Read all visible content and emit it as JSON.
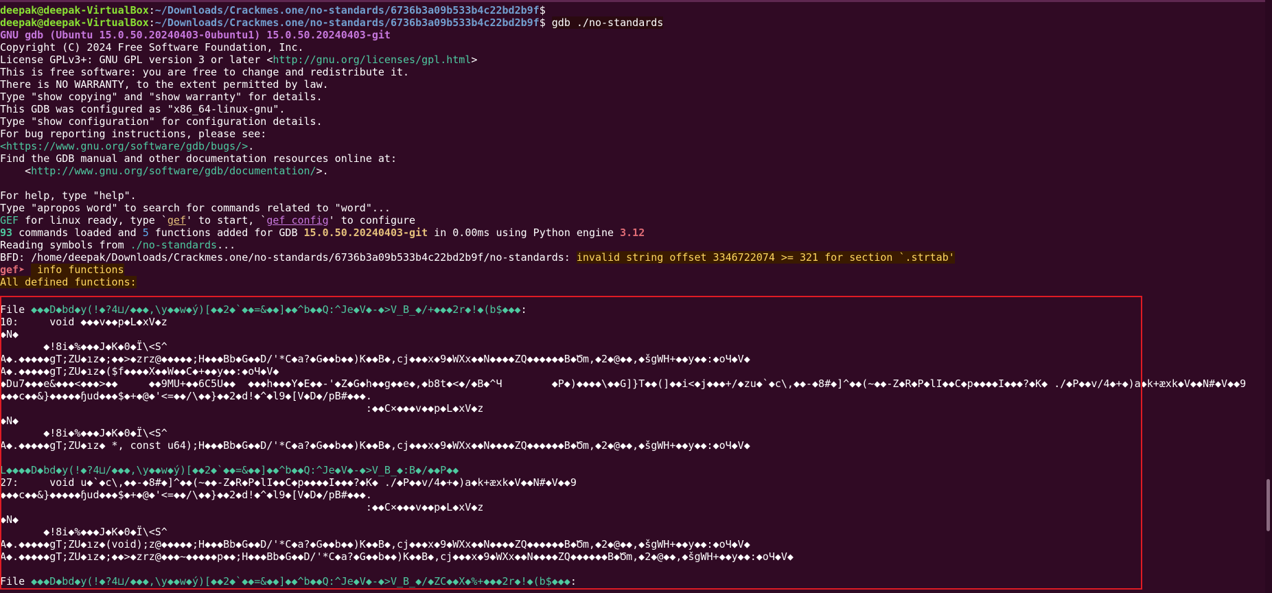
{
  "prompt": {
    "user": "deepak@deepak-VirtualBox",
    "path": "~/Downloads/Crackmes.one/no-standards/6736b3a09b533b4c22bd2b9f",
    "symbol": "$"
  },
  "cmd_gdb": "gdb ./no-standards",
  "gdb_version": "GNU gdb (Ubuntu 15.0.50.20240403-0ubuntu1) 15.0.50.20240403-git",
  "copyright": "Copyright (C) 2024 Free Software Foundation, Inc.",
  "license_pre": "License GPLv3+: GNU GPL version 3 or later <",
  "license_url": "http://gnu.org/licenses/gpl.html",
  "license_post": ">",
  "free_sw": "This is free software: you are free to change and redistribute it.",
  "no_warranty": "There is NO WARRANTY, to the extent permitted by law.",
  "show_copying": "Type \"show copying\" and \"show warranty\" for details.",
  "configured": "This GDB was configured as \"x86_64-linux-gnu\".",
  "show_config": "Type \"show configuration\" for configuration details.",
  "bug_report": "For bug reporting instructions, please see:",
  "bug_url": "<https://www.gnu.org/software/gdb/bugs/>",
  "bug_post": ".",
  "find_manual": "Find the GDB manual and other documentation resources online at:",
  "doc_pre": "    <",
  "doc_url": "http://www.gnu.org/software/gdb/documentation/",
  "doc_post": ">.",
  "help": "For help, type \"help\".",
  "apropos": "Type \"apropos word\" to search for commands related to \"word\"...",
  "gef_ready": {
    "a": "GEF",
    "b": " for linux ready, type `",
    "c": "gef",
    "d": "' to start, `",
    "e": "gef config",
    "f": "' to configure"
  },
  "commands_loaded": {
    "n1": "93",
    "t1": " commands loaded and ",
    "n2": "5",
    "t2": " functions added for GDB ",
    "ver": "15.0.50.20240403-git",
    "t3": " in 0.00ms using Python engine ",
    "py": "3.12"
  },
  "reading_pre": "Reading symbols from ",
  "reading_file": "./no-standards",
  "reading_post": "...",
  "bfd_pre": "BFD: /home/deepak/Downloads/Crackmes.one/no-standards/6736b3a09b533b4c22bd2b9f/no-standards: ",
  "bfd_error": "invalid string offset 3346722074 >= 321 for section `.strtab'",
  "gef_prompt": "gef➤ ",
  "cmd_info": " info functions",
  "all_defined": "All defined functions:",
  "garbled_lines": [
    {
      "a": "File ",
      "g": "◆◆◆D◆bd◆y(!◆?4⊔/◆◆◆,\\y◆◆w◆ý)[◆◆2◆`◆◆=&◆◆]◆◆^b◆◆Q:^Je◆V◆-◆>V̲B̲◆/+◆◆◆2r◆!◆(b$◆◆◆",
      "b": ":"
    },
    {
      "a": "10:     void ◆◆◆v◆◆p◆L◆xV◆z",
      "g": "",
      "b": ""
    },
    {
      "a": "◆N◆",
      "g": "",
      "b": ""
    },
    {
      "a": "       ◆!8i◆%◆◆◆J◆K◆0◆Ï\\<S^",
      "g": "",
      "b": ""
    },
    {
      "a": "A◆.◆◆◆◆◆gT;ZU◆ız◆;◆◆>◆zrz@◆◆◆◆◆;H◆◆◆Bb◆G◆◆D/'*C◆a?◆G◆◆b◆◆)K◆◆B◆,cj◆◆◆x◆9◆WXx◆◆N◆◆◆◆ZQ◆◆◆◆◆◆B◆Ծm,◆2◆@◆◆,◆šgWH+◆◆y◆◆:◆oЧ◆V◆",
      "g": "",
      "b": ""
    },
    {
      "a": "A◆.◆◆◆◆◆gT;ZU◆ız◆($f◆◆◆◆X◆◆W◆◆C◆+◆◆y◆◆:◆oЧ◆V◆",
      "g": "",
      "b": ""
    },
    {
      "a": "◆Du7◆◆◆e&◆◆◆<◆◆◆>◆◆     ◆◆9MU+◆◆6C5U◆◆  ◆◆◆h◆◆◆Y◆E◆◆-'◆Z◆G◆h◆◆g◆◆e◆,◆b8t◆<◆/◆B◆^Ч        ◆P◆)◆◆◆◆\\◆◆G]}T◆◆(]◆◆i<◆j◆◆◆+/◆zu◆`◆c\\,◆◆-◆8#◆]^◆◆(~◆◆-Z◆R◆P◆lI◆◆C◆p◆◆◆◆I◆◆◆?◆K◆ ./◆P◆◆v/4◆+◆)a◆k+æxk◆V◆◆N#◆V◆◆9",
      "g": "",
      "b": ""
    },
    {
      "a": "◆◆◆c◆◆&}◆◆◆◆◆ɧud◆◆◆$◆+◆@◆'<=◆◆/\\◆◆}◆◆2◆d!◆^◆l9◆[V◆D◆/pB#◆◆◆.",
      "g": "",
      "b": ""
    },
    {
      "a": "                                                           :◆◆C×◆◆◆v◆◆p◆L◆xV◆z",
      "g": "",
      "b": ""
    },
    {
      "a": "◆N◆",
      "g": "",
      "b": ""
    },
    {
      "a": "       ◆!8i◆%◆◆◆J◆K◆0◆Ï\\<S^",
      "g": "",
      "b": ""
    },
    {
      "a": "A◆.◆◆◆◆◆gT;ZU◆ız◆ *, const u64);H◆◆◆Bb◆G◆◆D/'*C◆a?◆G◆◆b◆◆)K◆◆B◆,cj◆◆◆x◆9◆WXx◆◆N◆◆◆◆ZQ◆◆◆◆◆◆B◆Ծm,◆2◆@◆◆,◆šgWH+◆◆y◆◆:◆oЧ◆V◆",
      "g": "",
      "b": ""
    },
    {
      "a": "",
      "g": "",
      "b": ""
    },
    {
      "a": "",
      "g": "L◆◆◆◆D◆bd◆y(!◆?4⊔/◆◆◆,\\y◆◆w◆ý)[◆◆2◆`◆◆=&◆◆]◆◆^b◆◆Q:^Je◆V◆-◆>V̲B̲◆:B◆/◆◆P◆◆",
      "b": ""
    },
    {
      "a": "27:     void u◆`◆c\\,◆◆-◆8#◆]^◆◆(~◆◆-Z◆R◆P◆lI◆◆C◆p◆◆◆◆I◆◆◆?◆K◆ ./◆P◆◆v/4◆+◆)a◆k+æxk◆V◆◆N#◆V◆◆9",
      "g": "",
      "b": ""
    },
    {
      "a": "◆◆◆c◆◆&}◆◆◆◆◆ɧud◆◆◆$◆+◆@◆'<=◆◆/\\◆◆}◆◆2◆d!◆^◆l9◆[V◆D◆/pB#◆◆◆.",
      "g": "",
      "b": ""
    },
    {
      "a": "                                                           :◆◆C×◆◆◆v◆◆p◆L◆xV◆z",
      "g": "",
      "b": ""
    },
    {
      "a": "◆N◆",
      "g": "",
      "b": ""
    },
    {
      "a": "       ◆!8i◆%◆◆◆J◆K◆0◆Ï\\<S^",
      "g": "",
      "b": ""
    },
    {
      "a": "A◆.◆◆◆◆◆gT;ZU◆ız◆(void);z@◆◆◆◆◆;H◆◆◆Bb◆G◆◆D/'*C◆a?◆G◆◆b◆◆)K◆◆B◆,cj◆◆◆x◆9◆WXx◆◆N◆◆◆◆ZQ◆◆◆◆◆◆B◆Ծm,◆2◆@◆◆,◆šgWH+◆◆y◆◆:◆oЧ◆V◆",
      "g": "",
      "b": ""
    },
    {
      "a": "A◆.◆◆◆◆◆gT;ZU◆ız◆;◆◆>◆zrz@◆◆◆~◆◆◆◆◆p◆◆;H◆◆◆Bb◆G◆◆D/'*C◆a?◆G◆◆b◆◆)K◆◆B◆,cj◆◆◆x◆9◆WXx◆◆N◆◆◆◆ZQ◆◆◆◆◆◆B◆Ծm,◆2◆@◆◆,◆šgWH+◆◆y◆◆:◆oЧ◆V◆",
      "g": "",
      "b": ""
    },
    {
      "a": "",
      "g": "",
      "b": ""
    },
    {
      "a": "File ",
      "g": "◆◆◆D◆bd◆y(!◆?4⊔/◆◆◆,\\y◆◆w◆ý)[◆◆2◆`◆◆=&◆◆]◆◆^b◆◆Q:^Je◆V◆-◆>V̲B̲◆/◆ZC◆◆X◆%+◆◆◆2r◆!◆(b$◆◆◆",
      "b": ":"
    }
  ],
  "colors": {
    "background": "#300a24",
    "highlight_box": "#e01b24",
    "prompt_user": "#8ae234",
    "prompt_path": "#729fcf"
  }
}
